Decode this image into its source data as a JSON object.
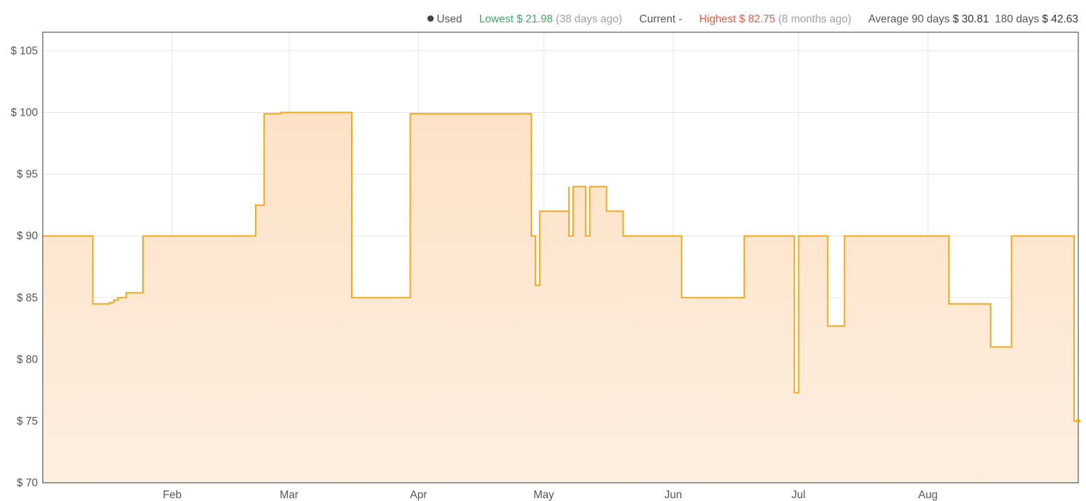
{
  "legend": {
    "used_label": "Used",
    "lowest_label": "Lowest",
    "lowest_value": "$ 21.98",
    "lowest_ago": "(38 days ago)",
    "current_label": "Current",
    "current_value": "-",
    "highest_label": "Highest",
    "highest_value": "$ 82.75",
    "highest_ago": "(8 months ago)",
    "average_label": "Average",
    "avg90_label": "90 days",
    "avg90_value": "$ 30.81",
    "avg180_label": "180 days",
    "avg180_value": "$ 42.63",
    "lowest_color": "#3cab62",
    "highest_color": "#e9573f"
  },
  "chart_data": {
    "type": "area",
    "interpolation": "step-after",
    "series": [
      {
        "name": "Used",
        "color": "#f7a71c",
        "fill": "#fde6cd",
        "points": [
          [
            "Jan 1",
            90
          ],
          [
            "Jan 13",
            84.5
          ],
          [
            "Jan 17",
            84.6
          ],
          [
            "Jan 18",
            84.8
          ],
          [
            "Jan 19",
            85
          ],
          [
            "Jan 21",
            85.4
          ],
          [
            "Jan 25",
            90
          ],
          [
            "Feb 21",
            92.5
          ],
          [
            "Feb 23",
            99.9
          ],
          [
            "Feb 27",
            100
          ],
          [
            "Mar 16",
            85
          ],
          [
            "Mar 30",
            99.9
          ],
          [
            "Apr 28",
            90
          ],
          [
            "Apr 29",
            86
          ],
          [
            "Apr 30",
            92
          ],
          [
            "May 7",
            94
          ],
          [
            "May 7",
            90
          ],
          [
            "May 8",
            94
          ],
          [
            "May 11",
            90
          ],
          [
            "May 12",
            94
          ],
          [
            "May 16",
            92
          ],
          [
            "May 20",
            90
          ],
          [
            "Jun 3",
            85
          ],
          [
            "Jun 18",
            90
          ],
          [
            "Jun 30",
            77.3
          ],
          [
            "Jul 1",
            90
          ],
          [
            "Jul 8",
            82.7
          ],
          [
            "Jul 12",
            90
          ],
          [
            "Aug 6",
            84.5
          ],
          [
            "Aug 16",
            81
          ],
          [
            "Aug 21",
            90
          ],
          [
            "Sep 5",
            75
          ],
          [
            "Sep 6",
            75
          ]
        ]
      }
    ],
    "x_ticks": [
      "Feb",
      "Mar",
      "Apr",
      "May",
      "Jun",
      "Jul",
      "Aug"
    ],
    "y_ticks": [
      "$ 70",
      "$ 75",
      "$ 80",
      "$ 85",
      "$ 90",
      "$ 95",
      "$ 100",
      "$ 105"
    ],
    "ylim": [
      70,
      106.5
    ],
    "grid": true,
    "legend_position": "top-right"
  }
}
